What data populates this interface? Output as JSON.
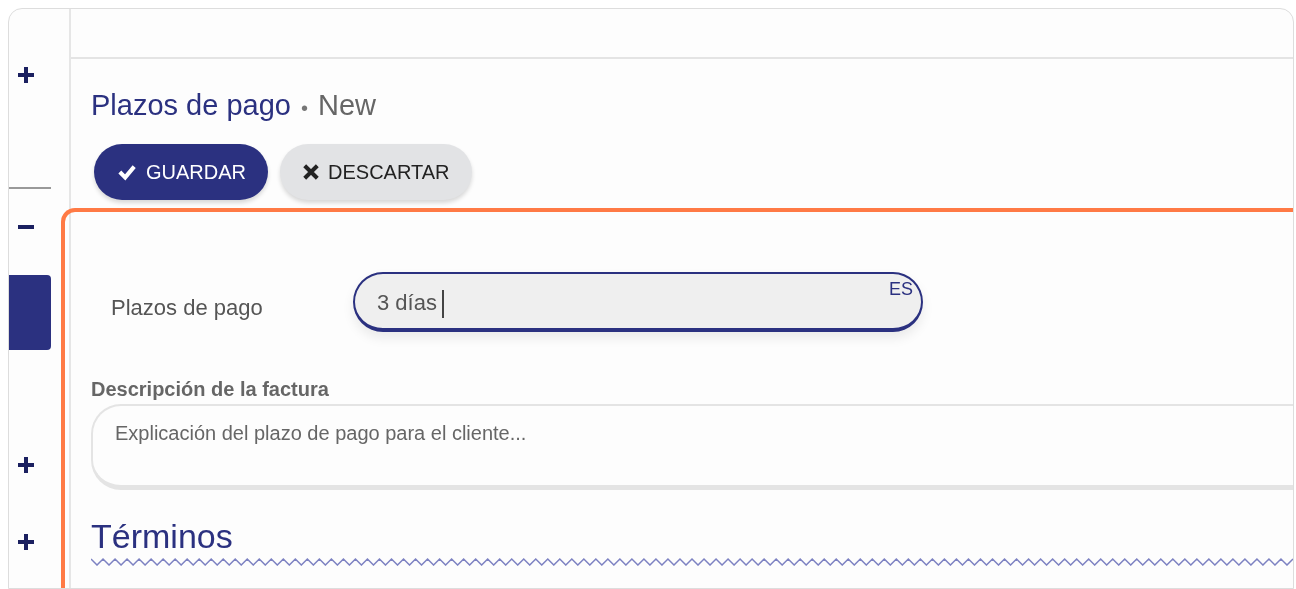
{
  "sidebar": {
    "items": [
      {
        "expanded": false
      },
      {
        "expanded": true
      },
      {
        "expanded": false
      },
      {
        "expanded": false
      }
    ]
  },
  "header": {
    "title": "Plazos de pago",
    "separator": "•",
    "status": "New"
  },
  "actions": [
    {
      "label": "GUARDAR",
      "kind": "primary"
    },
    {
      "label": "DESCARTAR",
      "kind": "secondary"
    }
  ],
  "form": {
    "name_field": {
      "label": "Plazos de pago",
      "value": "3 días",
      "language": "ES",
      "focused": true
    },
    "description_field": {
      "label": "Descripción de la factura",
      "placeholder": "Explicación del plazo de pago para el cliente..."
    },
    "section_title": "Términos"
  }
}
